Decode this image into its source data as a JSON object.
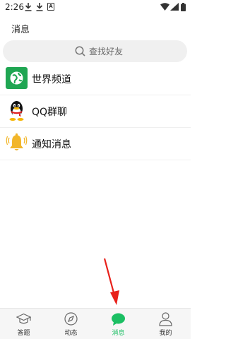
{
  "status_bar": {
    "time": "2:26"
  },
  "header": {
    "title": "消息"
  },
  "search": {
    "label": "查找好友"
  },
  "list": {
    "items": [
      {
        "label": "世界频道"
      },
      {
        "label": "QQ群聊"
      },
      {
        "label": "通知消息"
      }
    ]
  },
  "bottom_nav": {
    "tabs": [
      {
        "label": "答题"
      },
      {
        "label": "动态"
      },
      {
        "label": "消息"
      },
      {
        "label": "我的"
      }
    ],
    "active_tab": "消息"
  },
  "colors": {
    "accent": "#1bbf63",
    "world_channel_icon": "#1fa652",
    "bell": "#f2b62a",
    "annotation_arrow": "#e8201a"
  }
}
